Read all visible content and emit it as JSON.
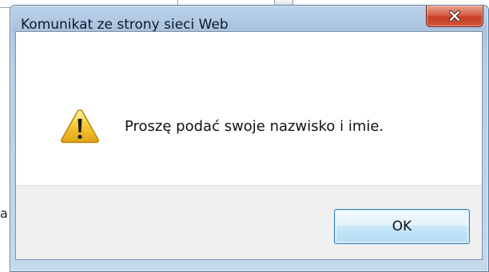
{
  "background": {
    "partial_letter": "a"
  },
  "dialog": {
    "title": "Komunikat ze strony sieci Web",
    "close_icon": "close-x-icon",
    "icon": "warning-triangle-icon",
    "message": "Proszę podać swoje nazwisko i imie.",
    "ok_label": "OK"
  },
  "colors": {
    "titlebar": "#b3cbe5",
    "close_button": "#c9482f",
    "ok_button_border": "#3c7fb1",
    "footer": "#f0f0f0",
    "warning_fill": "#f7c633"
  }
}
